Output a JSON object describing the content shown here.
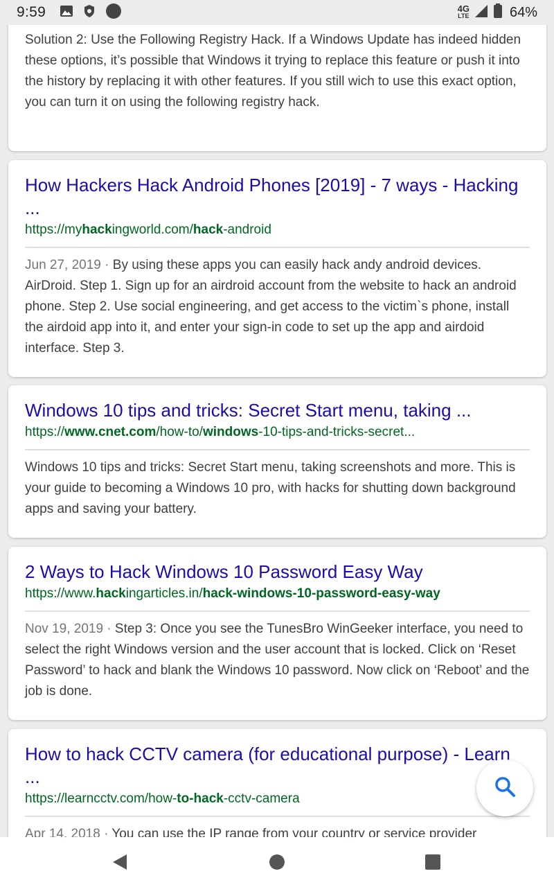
{
  "status_bar": {
    "time": "9:59",
    "network": "4G",
    "network_sub": "LTE",
    "battery": "64%",
    "icons": [
      "image-icon",
      "shield-icon",
      "circle-icon",
      "signal-icon",
      "battery-icon"
    ]
  },
  "results": [
    {
      "title": "",
      "url": "",
      "date": "",
      "snippet": "Solution 2: Use the Following Registry Hack. If a Windows Update has indeed hidden these options, it’s possible that Windows it trying to replace this feature or push it into the history by replacing it with other features. If you still wich to use this exact option, you can turn it on using the following registry hack."
    },
    {
      "title": "How Hackers Hack Android Phones [2019] - 7 ways - Hacking ...",
      "url_parts": [
        "https://my",
        "hack",
        "ingworld.com/",
        "hack",
        "-android"
      ],
      "date": "Jun 27, 2019",
      "snippet": "By using these apps you can easily hack andy android devices. AirDroid. Step 1. Sign up for an airdroid account from the website to hack an android phone. Step 2. Use social engineering, and get access to the victim`s phone, install the airdoid app into it, and enter your sign-in code to set up the app and airdoid interface. Step 3."
    },
    {
      "title": "Windows 10 tips and tricks: Secret Start menu, taking ...",
      "url_parts": [
        "https://",
        "www.cnet.com",
        "/how-to/",
        "windows",
        "-10-tips-and-tricks-secret..."
      ],
      "date": "",
      "snippet": "Windows 10 tips and tricks: Secret Start menu, taking screenshots and more. This is your guide to becoming a Windows 10 pro, with hacks for shutting down background apps and saving your battery."
    },
    {
      "title": "2 Ways to Hack Windows 10 Password Easy Way",
      "url_parts": [
        "https://www.",
        "hack",
        "ingarticles.in/",
        "hack-windows-10-password-easy-way",
        ""
      ],
      "date": "Nov 19, 2019",
      "snippet": "Step 3: Once you see the TunesBro WinGeeker interface, you need to select the right Windows version and the user account that is locked. Click on ‘Reset Password’ to hack and blank the Windows 10 password. Now click on ‘Reboot’ and the job is done."
    },
    {
      "title": "How to hack CCTV camera (for educational purpose) - Learn ...",
      "url_parts": [
        "https://learncctv.com/how-",
        "to-hack",
        "-cctv-camera",
        "",
        ""
      ],
      "date": "Apr 14, 2018",
      "snippet": "You can use the IP range from your country or service provider"
    }
  ],
  "separator": " · ",
  "fab": {
    "icon": "search-icon"
  },
  "nav_bar": {
    "icons": [
      "back-icon",
      "home-icon",
      "recents-icon"
    ]
  },
  "colors": {
    "title": "#1a0dab",
    "url": "#006621",
    "fab_icon": "#1a73e8"
  }
}
